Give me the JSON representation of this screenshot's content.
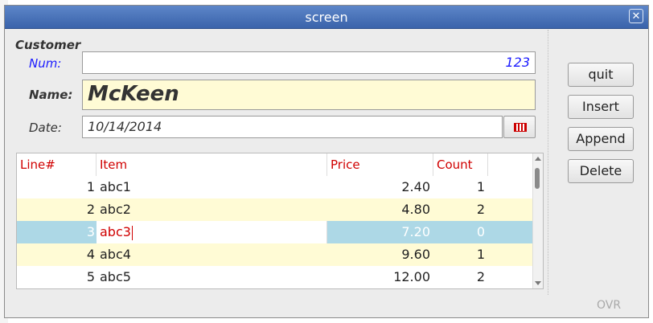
{
  "window": {
    "title": "screen",
    "close_glyph": "✕"
  },
  "customer": {
    "heading": "Customer",
    "num_label": "Num:",
    "num_value": "123",
    "name_label": "Name:",
    "name_value": "McKeen",
    "date_label": "Date:",
    "date_value": "10/14/2014"
  },
  "buttons": {
    "quit": "quit",
    "insert": "Insert",
    "append": "Append",
    "delete": "Delete"
  },
  "table": {
    "columns": [
      "Line#",
      "Item",
      "Price",
      "Count"
    ],
    "rows": [
      {
        "line": "1",
        "item": "abc1",
        "price": "2.40",
        "count": "1"
      },
      {
        "line": "2",
        "item": "abc2",
        "price": "4.80",
        "count": "2"
      },
      {
        "line": "3",
        "item": "abc3",
        "price": "7.20",
        "count": "0"
      },
      {
        "line": "4",
        "item": "abc4",
        "price": "9.60",
        "count": "1"
      },
      {
        "line": "5",
        "item": "abc5",
        "price": "12.00",
        "count": "2"
      }
    ],
    "selected_row": 3
  },
  "status": {
    "mode": "OVR"
  },
  "colors": {
    "title_bar": "#4a73b8",
    "header_text": "#d00000",
    "selected_row": "#add8e6",
    "alt_row": "#fffbd5",
    "num_label": "#1a1aff"
  },
  "icons": {
    "close": "close-icon",
    "calendar": "calendar-icon"
  }
}
